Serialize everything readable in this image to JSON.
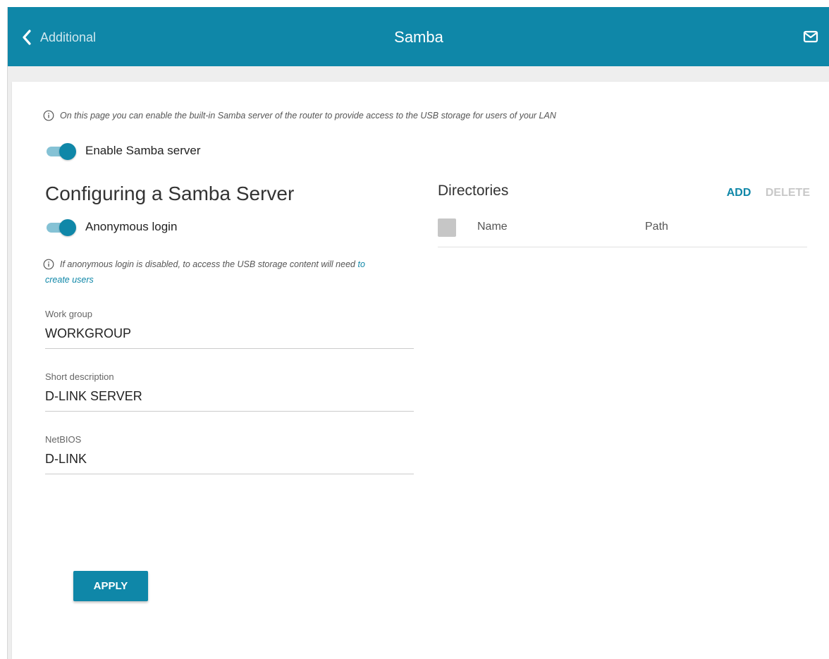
{
  "header": {
    "back_label": "Additional",
    "title": "Samba",
    "mail_icon": "mail-icon"
  },
  "colors": {
    "primary": "#0f87a8",
    "toggle_track": "#85c2d5",
    "disabled": "#c8c8c8"
  },
  "page": {
    "info_text": "On this page you can enable the built-in Samba server of the router to provide access to the USB storage for users of your LAN",
    "enable_samba": {
      "label": "Enable Samba server",
      "checked": true
    }
  },
  "config": {
    "title": "Configuring a Samba Server",
    "anonymous_login": {
      "label": "Anonymous login",
      "checked": true
    },
    "note_text": "If anonymous login is disabled, to access the USB storage content will need ",
    "note_link_part1": "to",
    "note_link_part2": "create users",
    "fields": {
      "workgroup": {
        "label": "Work group",
        "value": "WORKGROUP"
      },
      "description": {
        "label": "Short description",
        "value": "D-LINK SERVER"
      },
      "netbios": {
        "label": "NetBIOS",
        "value": "D-LINK"
      }
    },
    "apply_label": "APPLY"
  },
  "directories": {
    "title": "Directories",
    "add_label": "ADD",
    "delete_label": "DELETE",
    "columns": {
      "name": "Name",
      "path": "Path"
    },
    "rows": []
  }
}
